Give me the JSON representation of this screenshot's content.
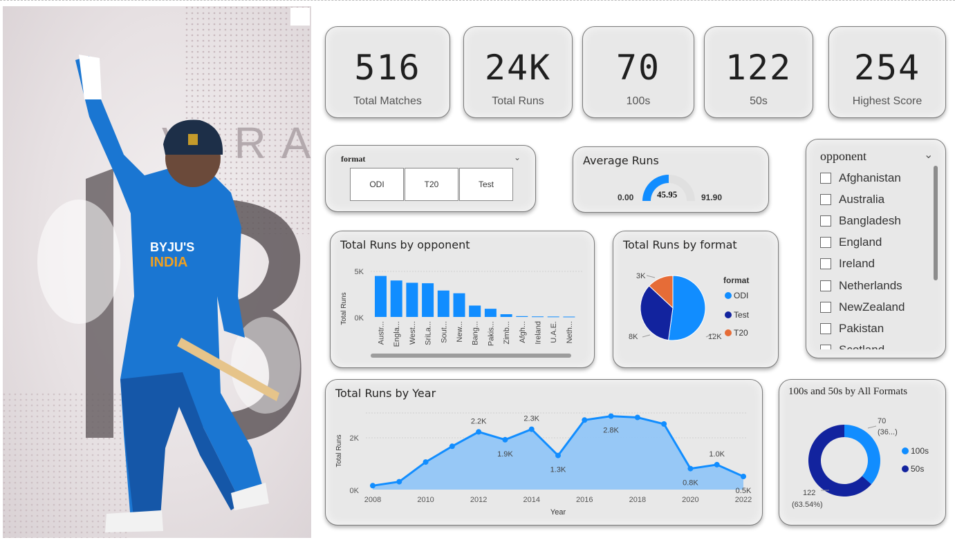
{
  "kpis": [
    {
      "value": "516",
      "label": "Total Matches"
    },
    {
      "value": "24K",
      "label": "Total Runs"
    },
    {
      "value": "70",
      "label": "100s"
    },
    {
      "value": "122",
      "label": "50s"
    },
    {
      "value": "254",
      "label": "Highest Score"
    }
  ],
  "format_slicer": {
    "title": "format",
    "options": [
      "ODI",
      "T20",
      "Test"
    ]
  },
  "gauge": {
    "title": "Average Runs",
    "min": "0.00",
    "value": "45.95",
    "max": "91.90",
    "fraction": 0.5
  },
  "opponent_slicer": {
    "title": "opponent",
    "items": [
      "Afghanistan",
      "Australia",
      "Bangladesh",
      "England",
      "Ireland",
      "Netherlands",
      "NewZealand",
      "Pakistan",
      "Scotland"
    ]
  },
  "hero": {
    "watermark_letters": "VIRAT",
    "jersey_sponsor": "BYJU'S",
    "jersey_team": "INDIA",
    "jersey_number": "18"
  },
  "colors": {
    "primary": "#118dff",
    "dark": "#12239e",
    "orange": "#e66c37",
    "card": "#e8e8e8"
  },
  "chart_data": [
    {
      "type": "bar",
      "title": "Total Runs by opponent",
      "ylabel": "Total Runs",
      "yticks": [
        "0K",
        "5K"
      ],
      "ylim": [
        0,
        5000
      ],
      "categories": [
        "Austr...",
        "Engla...",
        "West...",
        "SriLa...",
        "Sout...",
        "New...",
        "Bang...",
        "Pakis...",
        "Zimb...",
        "Afgh...",
        "Ireland",
        "U.A.E.",
        "Neth..."
      ],
      "values": [
        4500,
        4000,
        3750,
        3700,
        2900,
        2600,
        1250,
        900,
        300,
        90,
        60,
        50,
        40
      ],
      "color": "#118dff"
    },
    {
      "type": "pie",
      "title": "Total Runs by format",
      "legend_title": "format",
      "legend_position": "right",
      "slices": [
        {
          "name": "ODI",
          "value": 12000,
          "label": "12K",
          "color": "#118dff"
        },
        {
          "name": "Test",
          "value": 8000,
          "label": "8K",
          "color": "#12239e"
        },
        {
          "name": "T20",
          "value": 3000,
          "label": "3K",
          "color": "#e66c37"
        }
      ]
    },
    {
      "type": "area",
      "title": "Total Runs by Year",
      "xlabel": "Year",
      "ylabel": "Total Runs",
      "yticks": [
        "0K",
        "2K"
      ],
      "ylim": [
        0,
        3000
      ],
      "xticks": [
        "2008",
        "2010",
        "2012",
        "2014",
        "2016",
        "2018",
        "2020",
        "2022"
      ],
      "x": [
        2008,
        2009,
        2010,
        2011,
        2012,
        2013,
        2014,
        2015,
        2016,
        2017,
        2018,
        2019,
        2020,
        2021,
        2022
      ],
      "values": [
        150,
        300,
        1050,
        1650,
        2200,
        1900,
        2300,
        1300,
        2650,
        2800,
        2750,
        2500,
        800,
        950,
        500
      ],
      "labels": {
        "2012": "2.2K",
        "2013": "1.9K",
        "2014": "2.3K",
        "2015": "1.3K",
        "2017": "2.8K",
        "2020": "0.8K",
        "2021": "1.0K",
        "2022": "0.5K"
      },
      "color": "#118dff"
    },
    {
      "type": "donut",
      "title": "100s and 50s by All Formats",
      "legend_position": "right",
      "slices": [
        {
          "name": "100s",
          "value": 70,
          "label": "70",
          "pct_label": "(36...)",
          "color": "#118dff"
        },
        {
          "name": "50s",
          "value": 122,
          "label": "122",
          "pct_label": "(63.54%)",
          "color": "#12239e"
        }
      ]
    }
  ]
}
